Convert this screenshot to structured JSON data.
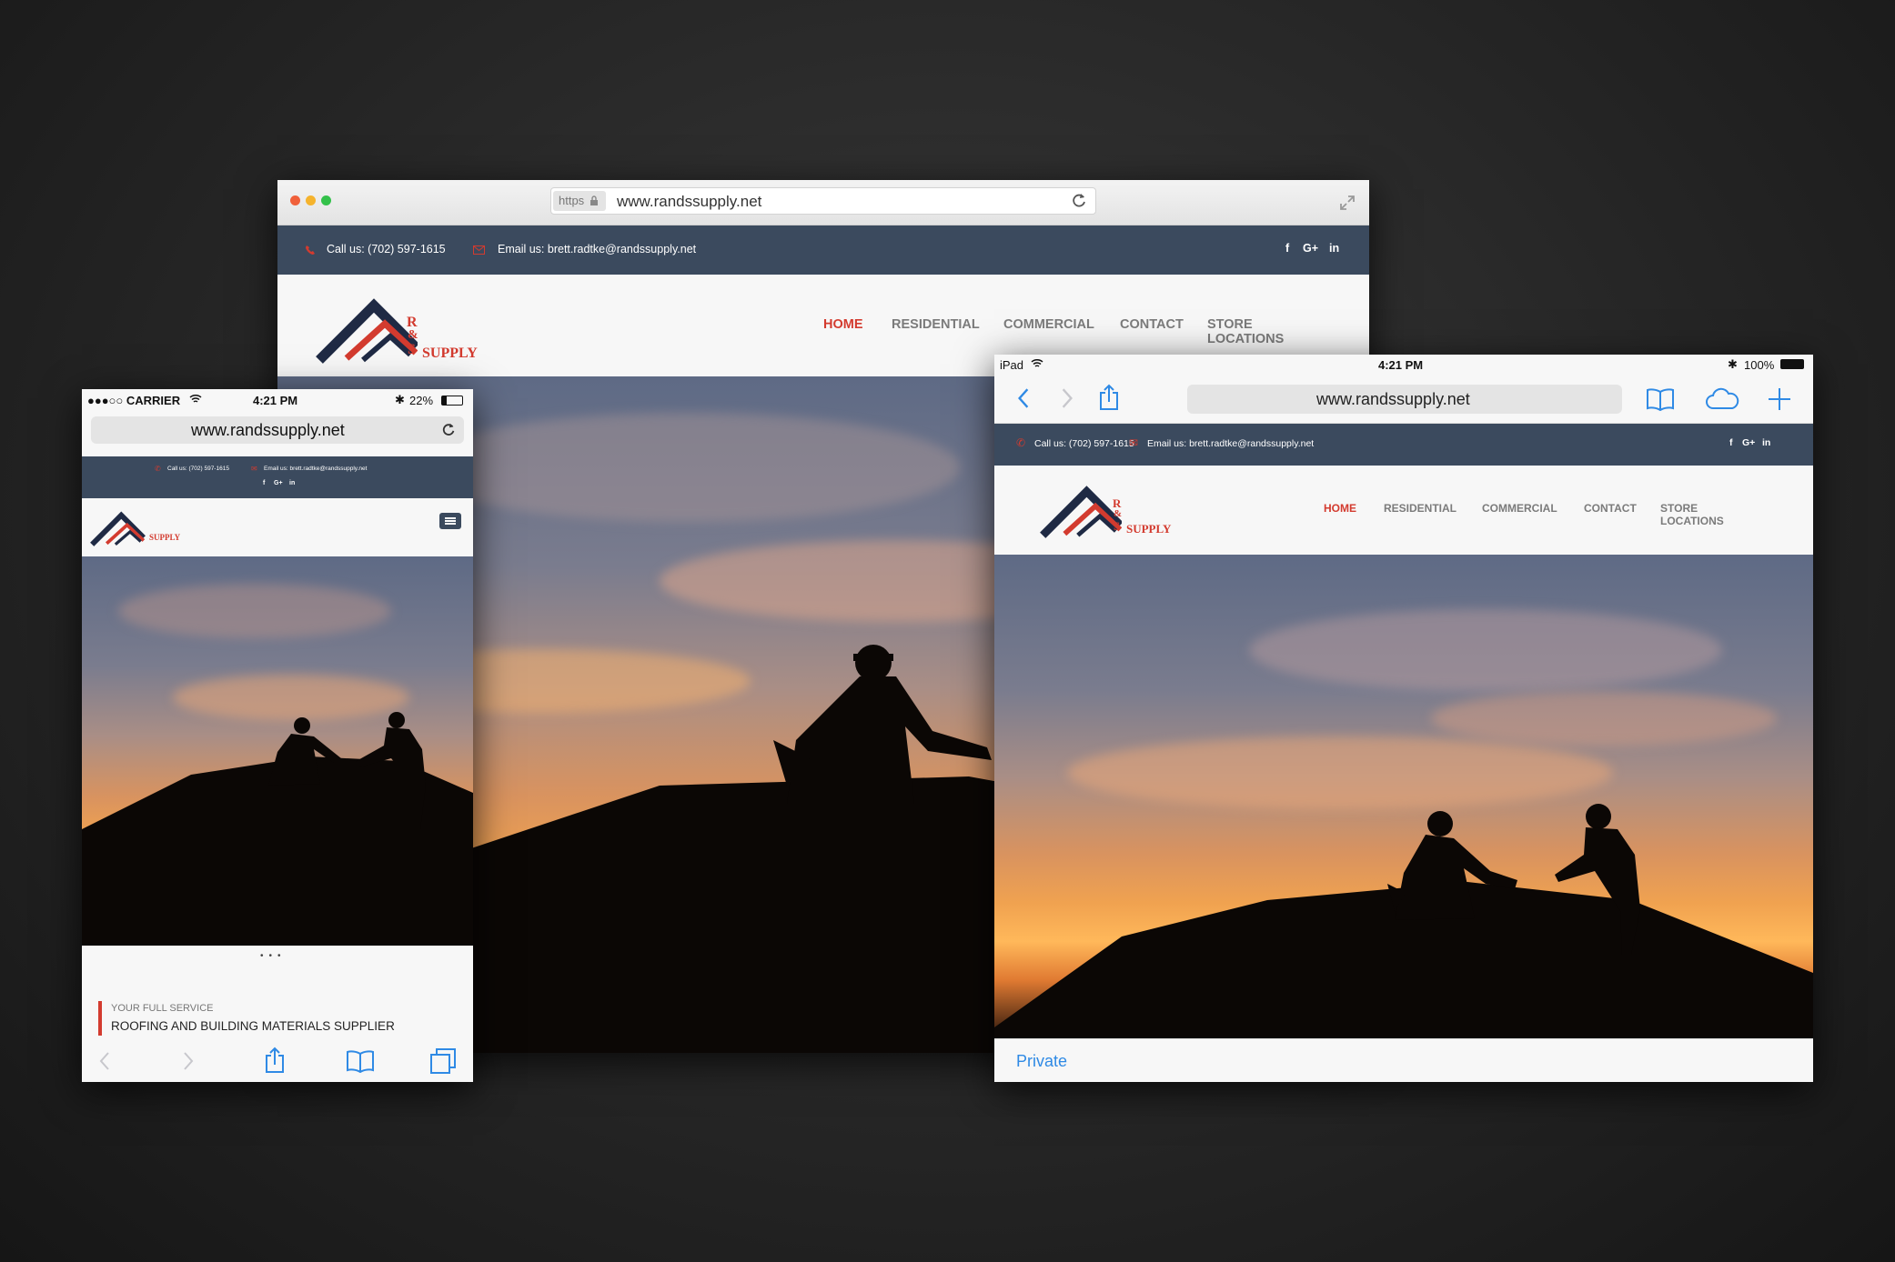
{
  "desktop": {
    "url_scheme": "https",
    "url": "www.randssupply.net",
    "call_text": "Call us: (702) 597-1615",
    "email_text": "Email us: brett.radtke@randssupply.net",
    "social": [
      "f",
      "G+",
      "in"
    ],
    "nav": [
      "HOME",
      "RESIDENTIAL",
      "COMMERCIAL",
      "CONTACT",
      "STORE LOCATIONS"
    ],
    "window_dots": [
      "#f0603a",
      "#f5b32d",
      "#33c14a"
    ]
  },
  "logo": {
    "letters": [
      "R",
      "&",
      "S"
    ],
    "word": "SUPPLY"
  },
  "phone": {
    "carrier": "●●●○○ CARRIER",
    "time": "4:21 PM",
    "battery": "22%",
    "url": "www.randssupply.net",
    "call_text": "Call us: (702) 597-1615",
    "email_text": "Email us: brett.radtke@randssupply.net",
    "social": [
      "f",
      "G+",
      "in"
    ],
    "tagline_small": "YOUR FULL SERVICE",
    "tagline_main": "ROOFING AND BUILDING MATERIALS SUPPLIER"
  },
  "tablet": {
    "device": "iPad",
    "time": "4:21 PM",
    "battery": "100%",
    "url": "www.randssupply.net",
    "call_text": "Call us: (702) 597-1615",
    "email_text": "Email us: brett.radtke@randssupply.net",
    "social": [
      "f",
      "G+",
      "in"
    ],
    "nav": [
      "HOME",
      "RESIDENTIAL",
      "COMMERCIAL",
      "CONTACT",
      "STORE LOCATIONS"
    ],
    "private_label": "Private"
  },
  "colors": {
    "brand_navy": "#1f2a44",
    "brand_red": "#d33b2f",
    "topbar": "#3b4a5e",
    "ios_blue": "#2f8ae5"
  }
}
